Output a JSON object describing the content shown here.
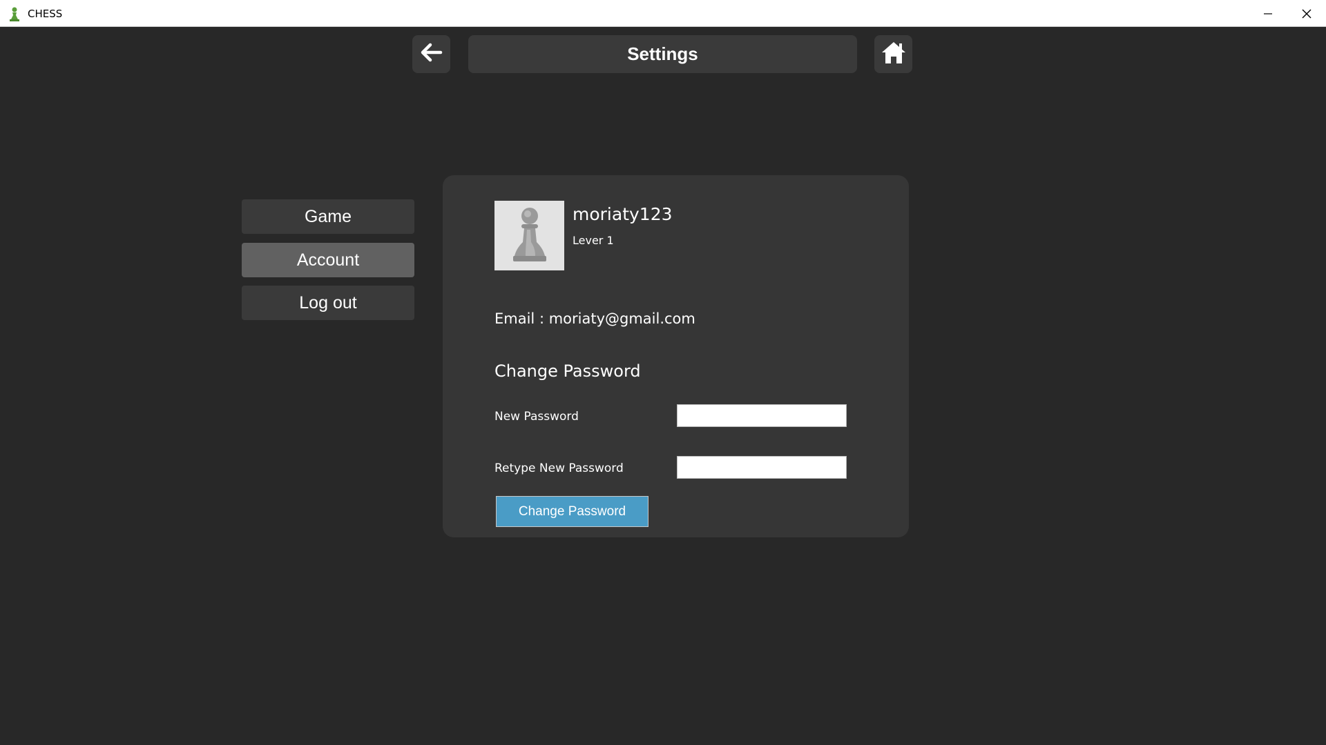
{
  "window": {
    "title": "CHESS",
    "app_icon": "pawn-icon",
    "accent_icon_color": "#5a9e3a"
  },
  "header": {
    "title": "Settings",
    "back_icon": "arrow-left-icon",
    "home_icon": "home-icon"
  },
  "sidebar": {
    "items": [
      {
        "label": "Game",
        "active": false
      },
      {
        "label": "Account",
        "active": true
      },
      {
        "label": "Log out",
        "active": false
      }
    ]
  },
  "account": {
    "avatar_icon": "pawn-avatar-icon",
    "username": "moriaty123",
    "level": "Lever 1",
    "email_line": "Email : moriaty@gmail.com",
    "change_password_heading": "Change Password",
    "new_password_label": "New Password",
    "new_password_value": "",
    "retype_password_label": "Retype New Password",
    "retype_password_value": "",
    "submit_label": "Change Password",
    "submit_color": "#4a9cc6"
  }
}
